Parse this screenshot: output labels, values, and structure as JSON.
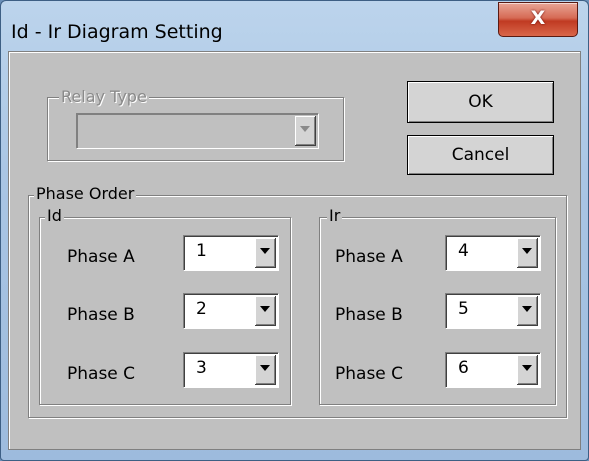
{
  "window": {
    "title": "Id - Ir Diagram Setting",
    "close_glyph": "X"
  },
  "relay_type": {
    "legend": "Relay Type",
    "value": ""
  },
  "buttons": {
    "ok": "OK",
    "cancel": "Cancel"
  },
  "phase_order": {
    "legend": "Phase Order",
    "id_group": {
      "legend": "Id",
      "rows": [
        {
          "label": "Phase A",
          "value": "1"
        },
        {
          "label": "Phase B",
          "value": "2"
        },
        {
          "label": "Phase C",
          "value": "3"
        }
      ]
    },
    "ir_group": {
      "legend": "Ir",
      "rows": [
        {
          "label": "Phase A",
          "value": "4"
        },
        {
          "label": "Phase B",
          "value": "5"
        },
        {
          "label": "Phase C",
          "value": "6"
        }
      ]
    }
  }
}
